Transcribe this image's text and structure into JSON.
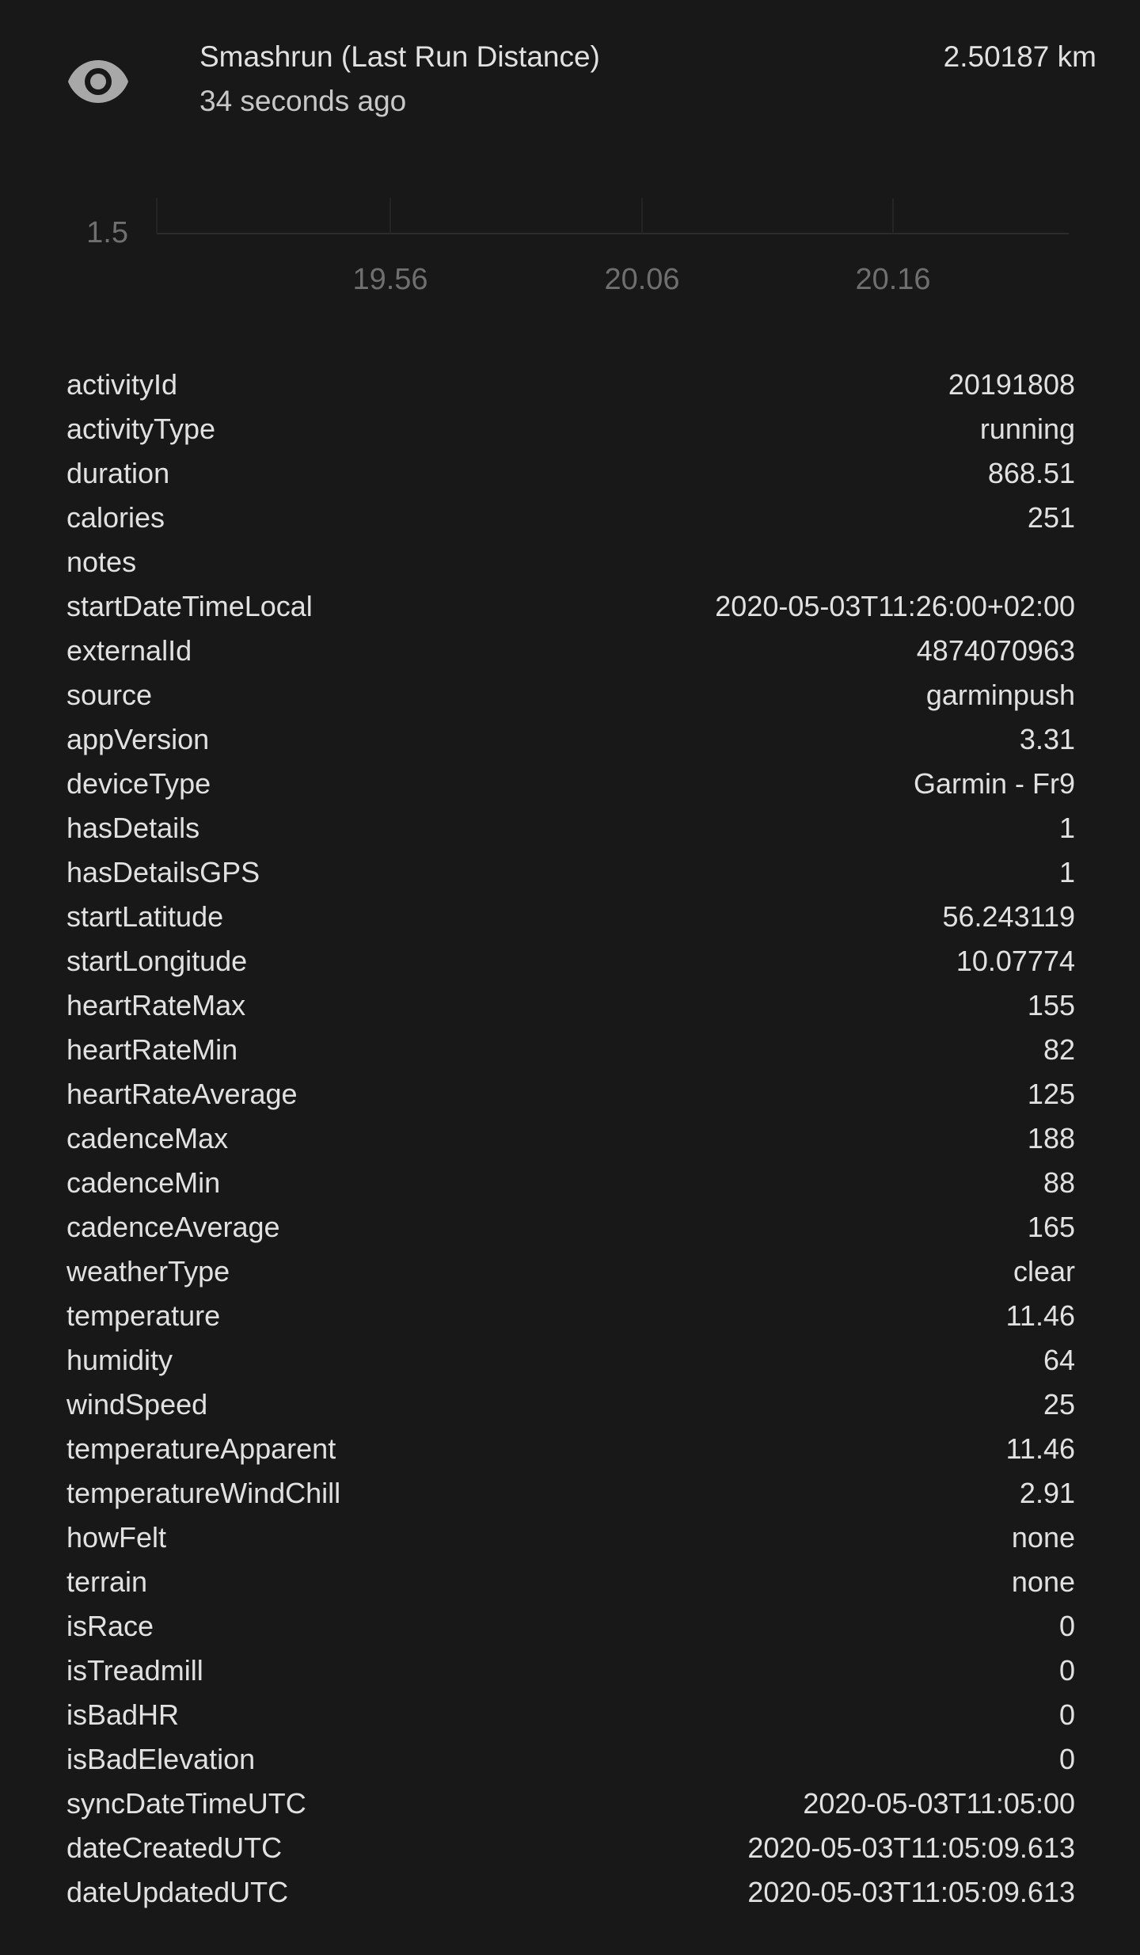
{
  "entity": {
    "icon": "eye-icon",
    "name": "Smashrun (Last Run Distance)",
    "last_changed": "34 seconds ago",
    "state": "2.50187 km"
  },
  "history_chart": {
    "y_label": "1.5",
    "x_labels": [
      "19.56",
      "20.06",
      "20.16"
    ]
  },
  "colors": {
    "background": "#181818",
    "text_primary": "#e1e1e1",
    "text_secondary": "#c8c8c8",
    "axis_text": "#6f6f6f",
    "grid": "#2c2c2c",
    "icon": "#a8a8a8"
  },
  "attributes": [
    {
      "key": "activityId",
      "value": "20191808"
    },
    {
      "key": "activityType",
      "value": "running"
    },
    {
      "key": "duration",
      "value": "868.51"
    },
    {
      "key": "calories",
      "value": "251"
    },
    {
      "key": "notes",
      "value": ""
    },
    {
      "key": "startDateTimeLocal",
      "value": "2020-05-03T11:26:00+02:00"
    },
    {
      "key": "externalId",
      "value": "4874070963"
    },
    {
      "key": "source",
      "value": "garminpush"
    },
    {
      "key": "appVersion",
      "value": "3.31"
    },
    {
      "key": "deviceType",
      "value": "Garmin - Fr9"
    },
    {
      "key": "hasDetails",
      "value": "1"
    },
    {
      "key": "hasDetailsGPS",
      "value": "1"
    },
    {
      "key": "startLatitude",
      "value": "56.243119"
    },
    {
      "key": "startLongitude",
      "value": "10.07774"
    },
    {
      "key": "heartRateMax",
      "value": "155"
    },
    {
      "key": "heartRateMin",
      "value": "82"
    },
    {
      "key": "heartRateAverage",
      "value": "125"
    },
    {
      "key": "cadenceMax",
      "value": "188"
    },
    {
      "key": "cadenceMin",
      "value": "88"
    },
    {
      "key": "cadenceAverage",
      "value": "165"
    },
    {
      "key": "weatherType",
      "value": "clear"
    },
    {
      "key": "temperature",
      "value": "11.46"
    },
    {
      "key": "humidity",
      "value": "64"
    },
    {
      "key": "windSpeed",
      "value": "25"
    },
    {
      "key": "temperatureApparent",
      "value": "11.46"
    },
    {
      "key": "temperatureWindChill",
      "value": "2.91"
    },
    {
      "key": "howFelt",
      "value": "none"
    },
    {
      "key": "terrain",
      "value": "none"
    },
    {
      "key": "isRace",
      "value": "0"
    },
    {
      "key": "isTreadmill",
      "value": "0"
    },
    {
      "key": "isBadHR",
      "value": "0"
    },
    {
      "key": "isBadElevation",
      "value": "0"
    },
    {
      "key": "syncDateTimeUTC",
      "value": "2020-05-03T11:05:00"
    },
    {
      "key": "dateCreatedUTC",
      "value": "2020-05-03T11:05:09.613"
    },
    {
      "key": "dateUpdatedUTC",
      "value": "2020-05-03T11:05:09.613"
    }
  ]
}
